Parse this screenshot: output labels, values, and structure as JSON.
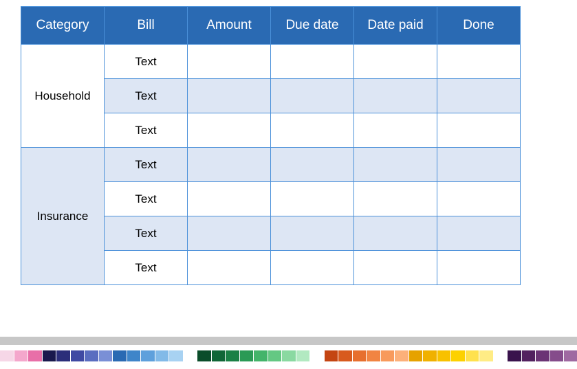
{
  "table": {
    "headers": [
      "Category",
      "Bill",
      "Amount",
      "Due date",
      "Date paid",
      "Done"
    ],
    "groups": [
      {
        "category": "Household",
        "category_shaded": false,
        "rows": [
          {
            "bill": "Text",
            "amount": "",
            "due_date": "",
            "date_paid": "",
            "done": "",
            "shaded": false
          },
          {
            "bill": "Text",
            "amount": "",
            "due_date": "",
            "date_paid": "",
            "done": "",
            "shaded": true
          },
          {
            "bill": "Text",
            "amount": "",
            "due_date": "",
            "date_paid": "",
            "done": "",
            "shaded": false
          }
        ]
      },
      {
        "category": "Insurance",
        "category_shaded": true,
        "rows": [
          {
            "bill": "Text",
            "amount": "",
            "due_date": "",
            "date_paid": "",
            "done": "",
            "shaded": true
          },
          {
            "bill": "Text",
            "amount": "",
            "due_date": "",
            "date_paid": "",
            "done": "",
            "shaded": false
          },
          {
            "bill": "Text",
            "amount": "",
            "due_date": "",
            "date_paid": "",
            "done": "",
            "shaded": true
          },
          {
            "bill": "Text",
            "amount": "",
            "due_date": "",
            "date_paid": "",
            "done": "",
            "shaded": false
          }
        ]
      }
    ]
  },
  "palette": [
    "#f6d7e7",
    "#f4a7cc",
    "#e86fa8",
    "#19194d",
    "#2b2e7a",
    "#3f49a3",
    "#5a6dc0",
    "#7a8fd6",
    "#2a6ab3",
    "#3f85c9",
    "#5ea0dc",
    "#82bae8",
    "#a8d2f2",
    "#ffffff",
    "#0a4d2a",
    "#106637",
    "#1a8045",
    "#2a9a55",
    "#43b46a",
    "#64c883",
    "#8ad9a1",
    "#b2e9c1",
    "#ffffff",
    "#c44512",
    "#d85a1e",
    "#e76f2e",
    "#f18442",
    "#f89a5c",
    "#fcb07a",
    "#e6a200",
    "#f0b100",
    "#f8c100",
    "#fdd100",
    "#ffe14d",
    "#ffec85",
    "#ffffff",
    "#3a134d",
    "#52215f",
    "#6b3475",
    "#854c8b",
    "#9f69a1",
    "#b98ab8"
  ]
}
